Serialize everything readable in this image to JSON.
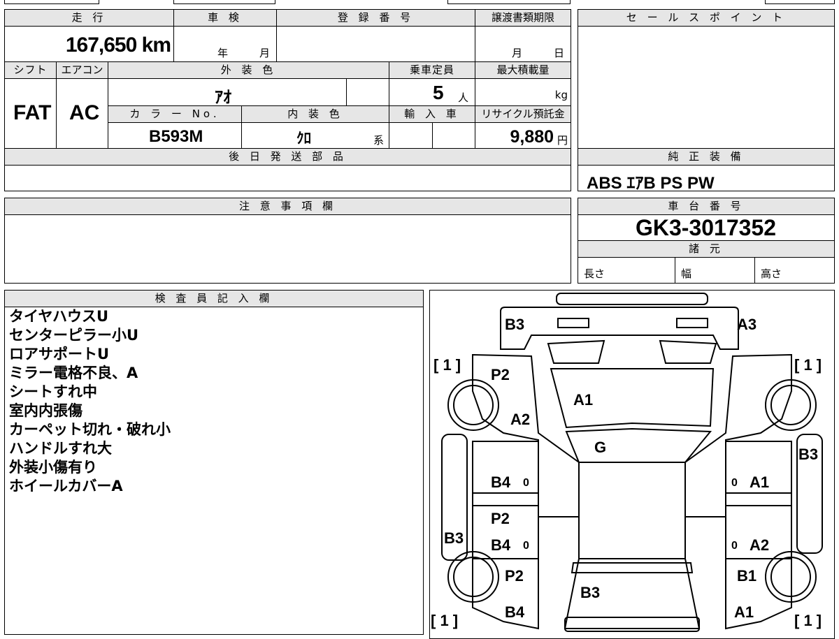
{
  "header": {
    "mileage_label": "走 行",
    "shaken_label": "車 検",
    "registration_label": "登 録 番 号",
    "transfer_label": "譲渡書類期限",
    "sales_point_label": "セ ー ル ス ポ イ ン ト"
  },
  "values": {
    "mileage": "167,650 km",
    "year_unit": "年",
    "month_unit": "月",
    "transfer_month": "月",
    "transfer_day": "日"
  },
  "row2": {
    "shift_label": "シフト",
    "ac_label": "エアコン",
    "exterior_label": "外 装 色",
    "capacity_label": "乗車定員",
    "load_label": "最大積載量",
    "shift": "FAT",
    "ac": "AC",
    "exterior_color": "ｱｵ",
    "capacity": "5",
    "capacity_unit": "人",
    "load_unit": "kg",
    "color_no_label": "カ ラ ー No.",
    "interior_label": "内 装 色",
    "import_label": "輸 入 車",
    "recycle_label": "リサイクル預託金",
    "color_no": "B593M",
    "interior_color": "ｸﾛ",
    "interior_suffix": "系",
    "recycle_fee": "9,880",
    "yen": "円"
  },
  "parts_label": "後 日 発 送 部 品",
  "equipment": {
    "label": "純 正 装 備",
    "value": "ABS ｴｱB PS PW"
  },
  "caution_label": "注 意 事 項 欄",
  "chassis": {
    "label": "車 台 番 号",
    "value": "GK3-3017352",
    "spec_label": "諸 元",
    "length": "長さ",
    "width": "幅",
    "height": "高さ"
  },
  "inspector": {
    "label": "検 査 員 記 入 欄",
    "notes": [
      "タイヤハウスU",
      "センターピラー小U",
      "ロアサポートU",
      "ミラー電格不良、A",
      "シートすれ中",
      "室内内張傷",
      "カーペット切れ・破れ小",
      "ハンドルすれ大",
      "外装小傷有り",
      "ホイールカバーA"
    ]
  },
  "diagram": {
    "marks": {
      "front_left_bumper": "B3",
      "front_right_bumper": "A3",
      "front_left_fender": "P2",
      "hood": "A1",
      "left_a2": "A2",
      "roof": "G",
      "left_b4_upper": "B4",
      "left_b4_upper_n": "0",
      "right_a1": "A1",
      "right_a1_n": "0",
      "right_b3": "B3",
      "left_p2_lower": "P2",
      "left_b3": "B3",
      "left_b4_lower": "B4",
      "left_b4_lower_n": "0",
      "right_a2": "A2",
      "right_a2_n": "0",
      "left_rear_p2": "P2",
      "right_rear_b1": "B1",
      "trunk_b3": "B3",
      "left_rear_b4": "B4",
      "right_rear_a1": "A1"
    },
    "tire_marks": [
      "[ 1 ]",
      "[ 1 ]",
      "[ 1 ]",
      "[ 1 ]"
    ]
  }
}
